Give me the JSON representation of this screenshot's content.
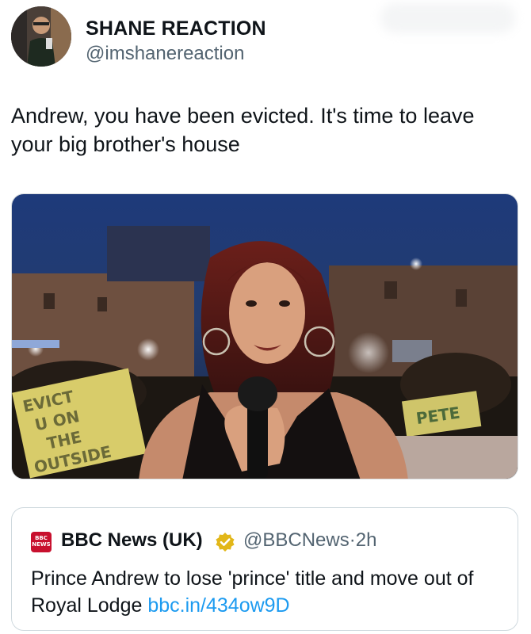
{
  "author": {
    "display_name": "SHANE REACTION",
    "handle": "@imshanereaction"
  },
  "tweet": {
    "text": "Andrew, you have been evicted. It's time to leave your big brother's house"
  },
  "media": {
    "description": "tv-presenter-with-microphone",
    "sign_left": [
      "EVICT",
      "U ON",
      "THE",
      "OUTSIDE"
    ],
    "sign_right": "PETE"
  },
  "quoted_tweet": {
    "logo_text": [
      "BBC",
      "NEWS"
    ],
    "display_name": "BBC News (UK)",
    "verified_badge": "gold-check-badge-icon",
    "handle": "@BBCNews",
    "separator": "·",
    "time": "2h",
    "text": "Prince Andrew to lose 'prince' title and move out of Royal Lodge ",
    "link": "bbc.in/434ow9D"
  },
  "colors": {
    "text": "#0f1419",
    "secondary": "#536471",
    "link": "#1d9bf0",
    "badge_gold": "#e2b719",
    "bbc_red": "#c8102e"
  }
}
